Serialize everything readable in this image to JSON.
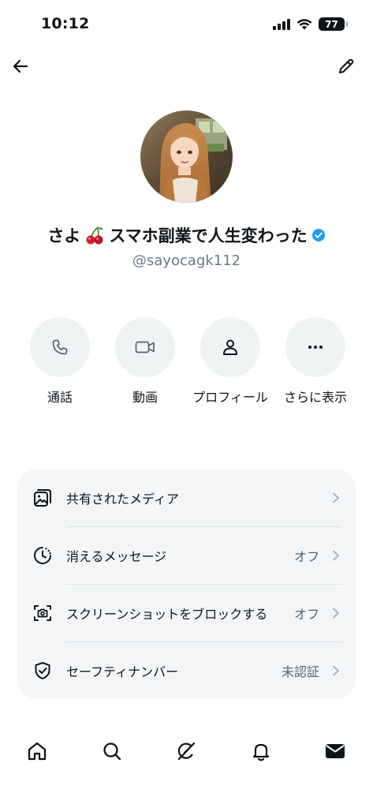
{
  "status_bar": {
    "time": "10:12",
    "battery": "77"
  },
  "top_bar": {
    "back_icon": "back-arrow-icon",
    "edit_icon": "pencil-icon"
  },
  "profile": {
    "name_prefix": "さよ",
    "name_suffix": "スマホ副業で人生変わった",
    "handle": "@sayocagk112",
    "verified_color": "#1d9bf0"
  },
  "actions": [
    {
      "label": "通話",
      "icon": "phone-icon"
    },
    {
      "label": "動画",
      "icon": "video-camera-icon"
    },
    {
      "label": "プロフィール",
      "icon": "person-icon"
    },
    {
      "label": "さらに表示",
      "icon": "more-dots-icon"
    }
  ],
  "settings": [
    {
      "label": "共有されたメディア",
      "value": "",
      "icon": "media-gallery-icon"
    },
    {
      "label": "消えるメッセージ",
      "value": "オフ",
      "icon": "disappearing-timer-icon"
    },
    {
      "label": "スクリーンショットをブロックする",
      "value": "オフ",
      "icon": "screenshot-camera-icon"
    },
    {
      "label": "セーフティナンバー",
      "value": "未認証",
      "icon": "shield-check-icon"
    }
  ],
  "bottom_nav": [
    "home-icon",
    "search-icon",
    "grok-icon",
    "notifications-bell-icon",
    "messages-envelope-icon"
  ]
}
